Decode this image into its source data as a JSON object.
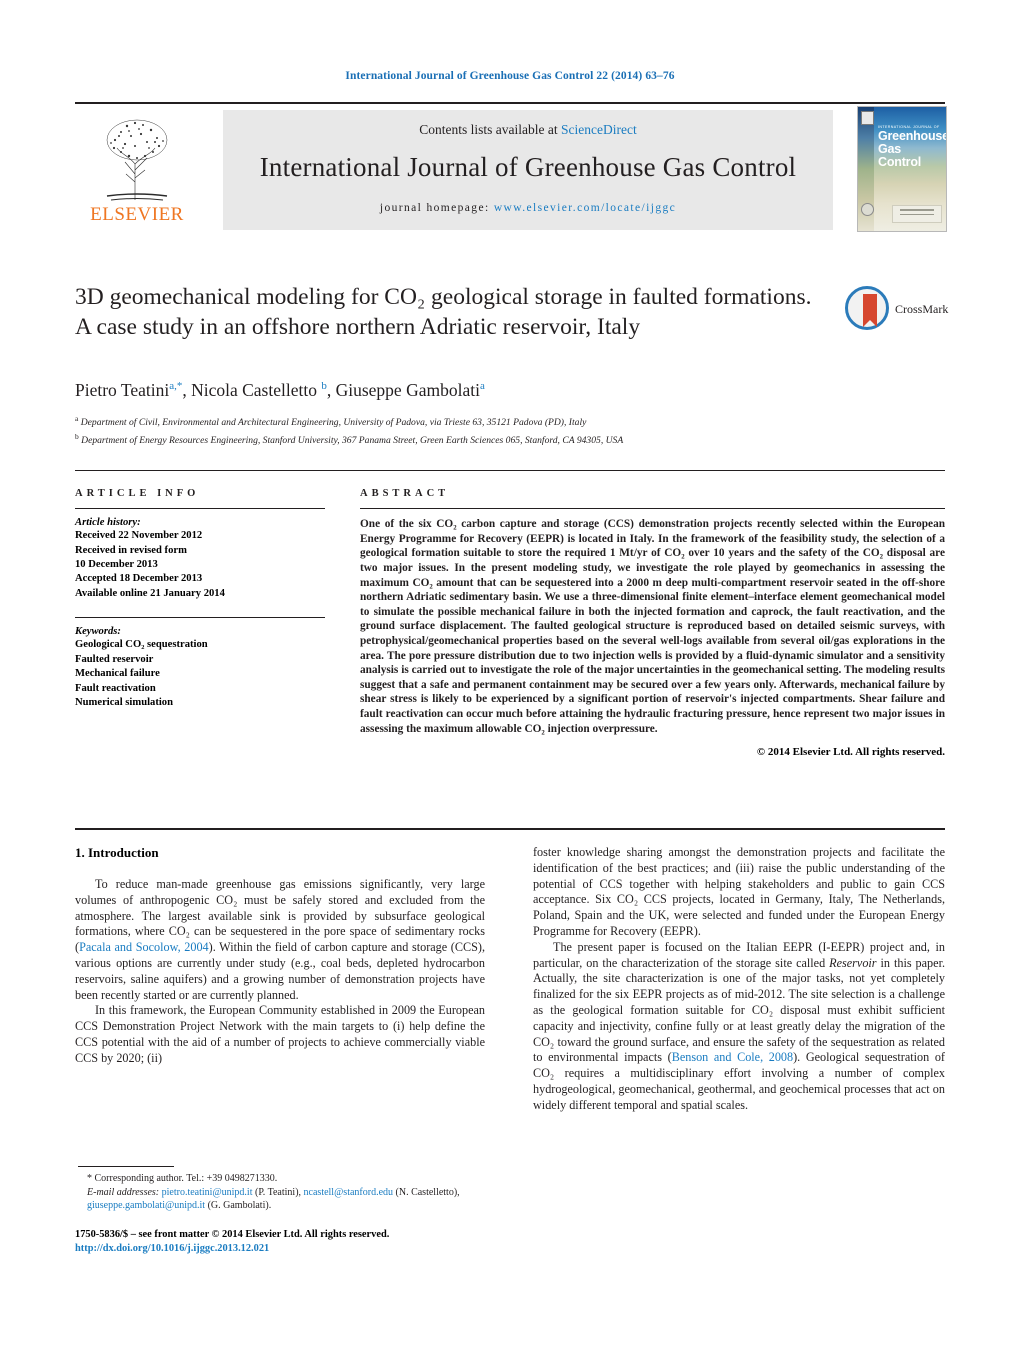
{
  "running_head": "International Journal of Greenhouse Gas Control 22 (2014) 63–76",
  "masthead": {
    "contents_prefix": "Contents lists available at ",
    "sciencedirect": "ScienceDirect",
    "journal_name": "International Journal of Greenhouse Gas Control",
    "homepage_prefix": "journal homepage: ",
    "homepage_url": "www.elsevier.com/locate/ijggc",
    "publisher": "ELSEVIER",
    "cover": {
      "supertitle": "INTERNATIONAL JOURNAL OF",
      "title_line1": "Greenhouse",
      "title_line2": "Gas Control"
    }
  },
  "article": {
    "title": "3D geomechanical modeling for CO₂ geological storage in faulted formations. A case study in an offshore northern Adriatic reservoir, Italy",
    "authors": "Pietro Teatini, Nicola Castelletto, Giuseppe Gambolati",
    "author_list": [
      {
        "name": "Pietro Teatini",
        "marks": "a,*"
      },
      {
        "name": "Nicola Castelletto",
        "marks": "b"
      },
      {
        "name": "Giuseppe Gambolati",
        "marks": "a"
      }
    ],
    "affiliations": [
      {
        "mark": "a",
        "text": "Department of Civil, Environmental and Architectural Engineering, University of Padova, via Trieste 63, 35121 Padova (PD), Italy"
      },
      {
        "mark": "b",
        "text": "Department of Energy Resources Engineering, Stanford University, 367 Panama Street, Green Earth Sciences 065, Stanford, CA 94305, USA"
      }
    ]
  },
  "crossmark": {
    "label": "CrossMark"
  },
  "article_info": {
    "heading": "ARTICLE INFO",
    "history_label": "Article history:",
    "history": [
      "Received 22 November 2012",
      "Received in revised form",
      "10 December 2013",
      "Accepted 18 December 2013",
      "Available online 21 January 2014"
    ],
    "keywords_label": "Keywords:",
    "keywords": [
      "Geological CO₂ sequestration",
      "Faulted reservoir",
      "Mechanical failure",
      "Fault reactivation",
      "Numerical simulation"
    ]
  },
  "abstract": {
    "heading": "ABSTRACT",
    "text": "One of the six CO₂ carbon capture and storage (CCS) demonstration projects recently selected within the European Energy Programme for Recovery (EEPR) is located in Italy. In the framework of the feasibility study, the selection of a geological formation suitable to store the required 1 Mt/yr of CO₂ over 10 years and the safety of the CO₂ disposal are two major issues. In the present modeling study, we investigate the role played by geomechanics in assessing the maximum CO₂ amount that can be sequestered into a 2000 m deep multi-compartment reservoir seated in the off-shore northern Adriatic sedimentary basin. We use a three-dimensional finite element–interface element geomechanical model to simulate the possible mechanical failure in both the injected formation and caprock, the fault reactivation, and the ground surface displacement. The faulted geological structure is reproduced based on detailed seismic surveys, with petrophysical/geomechanical properties based on the several well-logs available from several oil/gas explorations in the area. The pore pressure distribution due to two injection wells is provided by a fluid-dynamic simulator and a sensitivity analysis is carried out to investigate the role of the major uncertainties in the geomechanical setting. The modeling results suggest that a safe and permanent containment may be secured over a few years only. Afterwards, mechanical failure by shear stress is likely to be experienced by a significant portion of reservoir's injected compartments. Shear failure and fault reactivation can occur much before attaining the hydraulic fracturing pressure, hence represent two major issues in assessing the maximum allowable CO₂ injection overpressure.",
    "copyright": "© 2014 Elsevier Ltd. All rights reserved."
  },
  "body": {
    "section_number_title": "1. Introduction",
    "left_paragraphs": [
      {
        "segments": [
          {
            "text": "To reduce man-made greenhouse gas emissions significantly, very large volumes of anthropogenic CO₂ must be safely stored and excluded from the atmosphere. The largest available sink is provided by subsurface geological formations, where CO₂ can be sequestered in the pore space of sedimentary rocks ("
          },
          {
            "text": "Pacala and Socolow, 2004",
            "style": "cite"
          },
          {
            "text": "). Within the field of carbon capture and storage (CCS), various options are currently under study (e.g., coal beds, depleted hydrocarbon reservoirs, saline aquifers) and a growing number of demonstration projects have been recently started or are currently planned."
          }
        ]
      },
      {
        "segments": [
          {
            "text": "In this framework, the European Community established in 2009 the European CCS Demonstration Project Network with the main targets to (i) help define the CCS potential with the aid of a number of projects to achieve commercially viable CCS by 2020; (ii)"
          }
        ]
      }
    ],
    "right_paragraphs": [
      {
        "indent": false,
        "segments": [
          {
            "text": "foster knowledge sharing amongst the demonstration projects and facilitate the identification of the best practices; and (iii) raise the public understanding of the potential of CCS together with helping stakeholders and public to gain CCS acceptance. Six CO₂ CCS projects, located in Germany, Italy, The Netherlands, Poland, Spain and the UK, were selected and funded under the European Energy Programme for Recovery (EEPR)."
          }
        ]
      },
      {
        "indent": true,
        "segments": [
          {
            "text": "The present paper is focused on the Italian EEPR (I-EEPR) project and, in particular, on the characterization of the storage site called "
          },
          {
            "text": "Reservoir",
            "style": "italic"
          },
          {
            "text": " in this paper. Actually, the site characterization is one of the major tasks, not yet completely finalized for the six EEPR projects as of mid-2012. The site selection is a challenge as the geological formation suitable for CO₂ disposal must exhibit sufficient capacity and injectivity, confine fully or at least greatly delay the migration of the CO₂ toward the ground surface, and ensure the safety of the sequestration as related to environmental impacts ("
          },
          {
            "text": "Benson and Cole, 2008",
            "style": "cite"
          },
          {
            "text": "). Geological sequestration of CO₂ requires a multidisciplinary effort involving a number of complex hydrogeological, geomechanical, geothermal, and geochemical processes that act on widely different temporal and spatial scales."
          }
        ]
      }
    ]
  },
  "footnotes": {
    "corresponding": "* Corresponding author. Tel.: +39 0498271330.",
    "email_label": "E-mail addresses:",
    "emails": [
      {
        "address": "pietro.teatini@unipd.it",
        "owner": "(P. Teatini)"
      },
      {
        "address": "ncastell@stanford.edu",
        "owner": "(N. Castelletto)"
      },
      {
        "address": "giuseppe.gambolati@unipd.it",
        "owner": "(G. Gambolati)"
      }
    ]
  },
  "footer": {
    "issn_line": "1750-5836/$ – see front matter © 2014 Elsevier Ltd. All rights reserved.",
    "doi": "http://dx.doi.org/10.1016/j.ijggc.2013.12.021"
  },
  "colors": {
    "link": "#1a7cc1",
    "running_head": "#1a6fb5",
    "elsevier_orange": "#ef7622",
    "band_gray": "#e8e8e8",
    "crossmark_blue": "#2b7bba",
    "crossmark_red": "#d6472f"
  }
}
